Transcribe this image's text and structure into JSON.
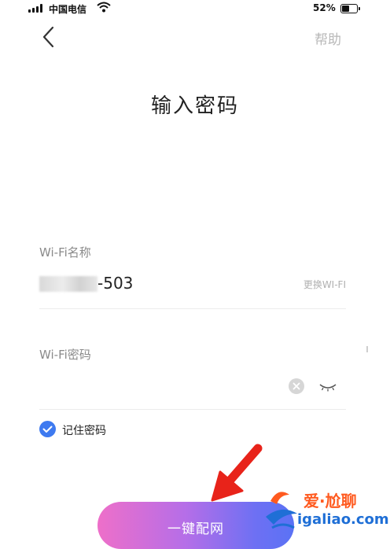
{
  "status_bar": {
    "carrier": "中国电信",
    "battery_text": "52%",
    "battery_level": 0.52,
    "signal_bars": 4
  },
  "nav": {
    "back_icon": "chevron-left-icon",
    "help_label": "帮助"
  },
  "page": {
    "title": "输入密码"
  },
  "wifi_name": {
    "label": "Wi-Fi名称",
    "ssid_suffix": "-503",
    "change_label": "更换WI-FI"
  },
  "wifi_password": {
    "label": "Wi-Fi密码",
    "value": "",
    "clear_icon": "clear-icon",
    "visibility_icon": "eye-closed-icon"
  },
  "remember": {
    "label": "记住密码",
    "checked": true
  },
  "actions": {
    "connect_label": "一键配网"
  },
  "watermark": {
    "brand": "爱·尬聊",
    "domain": "igaliao.com"
  },
  "colors": {
    "accent": "#3e7af0",
    "button_gradient_start": "#ee6fc9",
    "button_gradient_end": "#5a72f5",
    "arrow": "#e8231a",
    "watermark_orange": "#ff5a1f",
    "watermark_blue": "#1f6fd6"
  }
}
